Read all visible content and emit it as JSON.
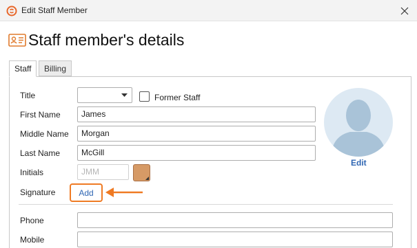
{
  "window": {
    "title": "Edit Staff Member",
    "icon": "app-logo-icon",
    "close_icon": "close-icon"
  },
  "heading": {
    "text": "Staff member's details",
    "icon": "id-card-icon"
  },
  "tabs": [
    {
      "label": "Staff",
      "active": true
    },
    {
      "label": "Billing",
      "active": false
    }
  ],
  "form": {
    "title": {
      "label": "Title",
      "value": ""
    },
    "former_staff": {
      "label": "Former Staff",
      "checked": false
    },
    "first_name": {
      "label": "First Name",
      "value": "James"
    },
    "middle_name": {
      "label": "Middle Name",
      "value": "Morgan"
    },
    "last_name": {
      "label": "Last Name",
      "value": "McGill"
    },
    "initials": {
      "label": "Initials",
      "value": "",
      "placeholder": "JMM",
      "color": "#d69a66"
    },
    "signature": {
      "label": "Signature",
      "action": "Add"
    },
    "phone": {
      "label": "Phone",
      "value": ""
    },
    "mobile": {
      "label": "Mobile",
      "value": ""
    }
  },
  "avatar": {
    "edit_label": "Edit",
    "icon": "person-silhouette-icon"
  },
  "colors": {
    "accent": "#ef7a23",
    "link": "#2f66b3",
    "avatar_bg": "#dde9f3",
    "avatar_figure": "#a9c3d8"
  }
}
